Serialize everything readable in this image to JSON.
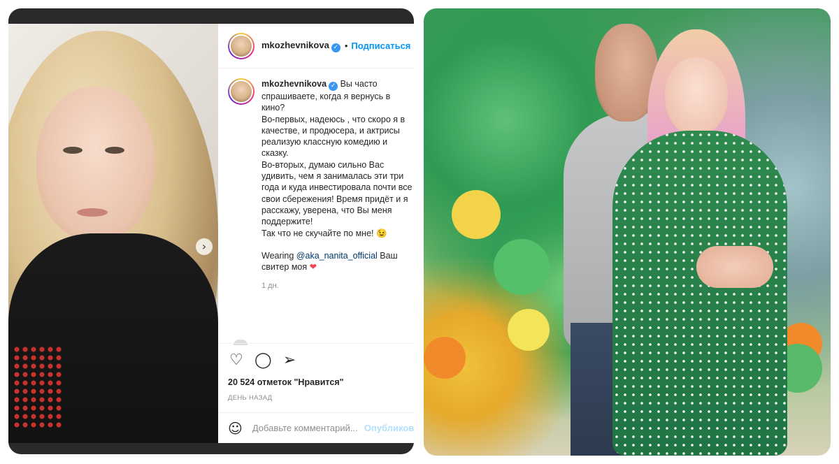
{
  "post": {
    "username": "mkozhevnikova",
    "follow_label": "Подписаться",
    "caption_lines": [
      "Вы часто спрашиваете, когда я вернусь в кино?",
      "Во-первых, надеюсь , что скоро я в качестве, и продюсера, и актрисы реализую классную комедию и сказку.",
      "Во-вторых, думаю сильно Вас удивить, чем я занималась эти три года и куда инвестировала почти все свои сбережения! Время придёт и я расскажу, уверена, что Вы меня поддержите!",
      "Так что не скучайте по мне! 😉"
    ],
    "wearing_prefix": "Wearing ",
    "wearing_tag": "@aka_nanita_official",
    "wearing_suffix": " Ваш свитер моя ",
    "heart": "❤",
    "time_ago": "1 дн.",
    "likes": "20 524 отметок \"Нравится\"",
    "posted_ago": "ДЕНЬ НАЗАД",
    "comment_placeholder": "Добавьте комментарий...",
    "publish_label": "Опубликовать"
  },
  "icons": [
    "heart-outline-icon",
    "comment-icon",
    "share-icon",
    "emoji-icon",
    "chevron-right-icon",
    "verified-badge-icon"
  ],
  "colors": {
    "link_blue": "#0095f6",
    "text": "#262626",
    "muted": "#8e8e8e",
    "like_red": "#ed4956"
  }
}
